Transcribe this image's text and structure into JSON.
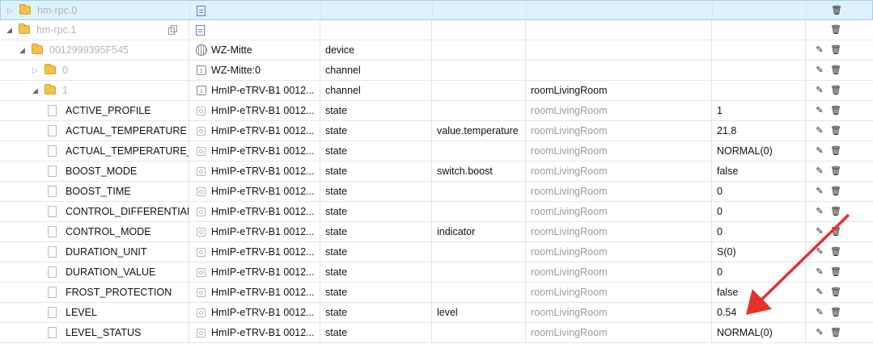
{
  "rows": [
    {
      "id": "hm-rpc.0",
      "indent": 0,
      "toggle": "collapsed",
      "kind": "folder",
      "icon": "doc",
      "name": "",
      "type": "",
      "role": "",
      "room": "",
      "value": "",
      "actions": [
        "delete"
      ],
      "selected": true,
      "muted": true
    },
    {
      "id": "hm-rpc.1",
      "indent": 0,
      "toggle": "expanded",
      "kind": "folder",
      "icon": "doc",
      "name": "",
      "type": "",
      "role": "",
      "room": "",
      "value": "",
      "actions": [
        "delete"
      ],
      "copy": true,
      "muted": true
    },
    {
      "id": "0012999395F545",
      "indent": 1,
      "toggle": "expanded",
      "kind": "folder",
      "icon": "device",
      "name": "WZ-Mitte",
      "type": "device",
      "role": "",
      "room": "",
      "value": "",
      "actions": [
        "edit",
        "delete"
      ],
      "muted": true
    },
    {
      "id": "0",
      "indent": 2,
      "toggle": "collapsed",
      "kind": "folder",
      "icon": "channel",
      "name": "WZ-Mitte:0",
      "type": "channel",
      "role": "",
      "room": "",
      "value": "",
      "actions": [
        "edit",
        "delete"
      ],
      "muted": true
    },
    {
      "id": "1",
      "indent": 2,
      "toggle": "expanded",
      "kind": "folder",
      "icon": "channel",
      "name": "HmIP-eTRV-B1 0012...",
      "type": "channel",
      "role": "",
      "room": "roomLivingRoom",
      "value": "",
      "actions": [
        "edit",
        "delete"
      ],
      "muted": true,
      "roomDark": true
    },
    {
      "id": "ACTIVE_PROFILE",
      "indent": 3,
      "kind": "file",
      "icon": "state",
      "name": "HmIP-eTRV-B1 0012...",
      "type": "state",
      "role": "",
      "room": "roomLivingRoom",
      "value": "1",
      "actions": [
        "edit",
        "delete"
      ]
    },
    {
      "id": "ACTUAL_TEMPERATURE",
      "indent": 3,
      "kind": "file",
      "icon": "state",
      "name": "HmIP-eTRV-B1 0012...",
      "type": "state",
      "role": "value.temperature",
      "room": "roomLivingRoom",
      "value": "21.8",
      "actions": [
        "edit",
        "delete"
      ]
    },
    {
      "id": "ACTUAL_TEMPERATURE_ST",
      "indent": 3,
      "kind": "file",
      "icon": "state",
      "name": "HmIP-eTRV-B1 0012...",
      "type": "state",
      "role": "",
      "room": "roomLivingRoom",
      "value": "NORMAL(0)",
      "actions": [
        "edit",
        "delete"
      ]
    },
    {
      "id": "BOOST_MODE",
      "indent": 3,
      "kind": "file",
      "icon": "state",
      "name": "HmIP-eTRV-B1 0012...",
      "type": "state",
      "role": "switch.boost",
      "room": "roomLivingRoom",
      "value": "false",
      "actions": [
        "edit",
        "delete"
      ]
    },
    {
      "id": "BOOST_TIME",
      "indent": 3,
      "kind": "file",
      "icon": "state",
      "name": "HmIP-eTRV-B1 0012...",
      "type": "state",
      "role": "",
      "room": "roomLivingRoom",
      "value": "0",
      "actions": [
        "edit",
        "delete"
      ]
    },
    {
      "id": "CONTROL_DIFFERENTIAL_T",
      "indent": 3,
      "kind": "file",
      "icon": "state",
      "name": "HmIP-eTRV-B1 0012...",
      "type": "state",
      "role": "",
      "room": "roomLivingRoom",
      "value": "0",
      "actions": [
        "edit",
        "delete"
      ]
    },
    {
      "id": "CONTROL_MODE",
      "indent": 3,
      "kind": "file",
      "icon": "state",
      "name": "HmIP-eTRV-B1 0012...",
      "type": "state",
      "role": "indicator",
      "room": "roomLivingRoom",
      "value": "0",
      "actions": [
        "edit",
        "delete"
      ]
    },
    {
      "id": "DURATION_UNIT",
      "indent": 3,
      "kind": "file",
      "icon": "state",
      "name": "HmIP-eTRV-B1 0012...",
      "type": "state",
      "role": "",
      "room": "roomLivingRoom",
      "value": "S(0)",
      "actions": [
        "edit",
        "delete"
      ]
    },
    {
      "id": "DURATION_VALUE",
      "indent": 3,
      "kind": "file",
      "icon": "state",
      "name": "HmIP-eTRV-B1 0012...",
      "type": "state",
      "role": "",
      "room": "roomLivingRoom",
      "value": "0",
      "actions": [
        "edit",
        "delete"
      ]
    },
    {
      "id": "FROST_PROTECTION",
      "indent": 3,
      "kind": "file",
      "icon": "state",
      "name": "HmIP-eTRV-B1 0012...",
      "type": "state",
      "role": "",
      "room": "roomLivingRoom",
      "value": "false",
      "actions": [
        "edit",
        "delete"
      ]
    },
    {
      "id": "LEVEL",
      "indent": 3,
      "kind": "file",
      "icon": "state",
      "name": "HmIP-eTRV-B1 0012...",
      "type": "state",
      "role": "level",
      "room": "roomLivingRoom",
      "value": "0.54",
      "actions": [
        "edit",
        "delete"
      ]
    },
    {
      "id": "LEVEL_STATUS",
      "indent": 3,
      "kind": "file",
      "icon": "state",
      "name": "HmIP-eTRV-B1 0012...",
      "type": "state",
      "role": "",
      "room": "roomLivingRoom",
      "value": "NORMAL(0)",
      "actions": [
        "edit",
        "delete"
      ]
    }
  ],
  "annotation": {
    "color": "#e8312a",
    "points_to_value": "0.54"
  },
  "icons": {
    "edit": "pencil-icon",
    "delete": "trash-icon"
  }
}
